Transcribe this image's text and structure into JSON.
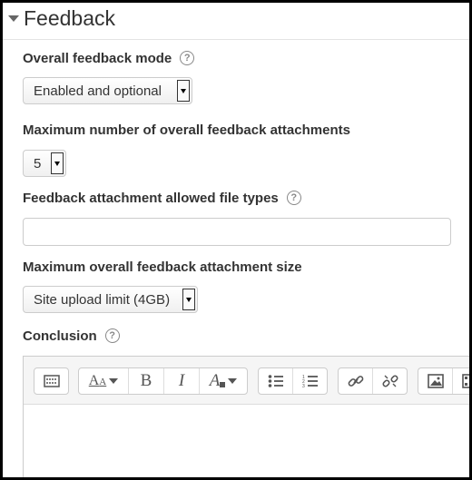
{
  "section": {
    "title": "Feedback"
  },
  "fields": {
    "feedback_mode": {
      "label": "Overall feedback mode",
      "value": "Enabled and optional"
    },
    "max_attachments": {
      "label": "Maximum number of overall feedback attachments",
      "value": "5"
    },
    "file_types": {
      "label": "Feedback attachment allowed file types",
      "value": ""
    },
    "max_size": {
      "label": "Maximum overall feedback attachment size",
      "value": "Site upload limit (4GB)"
    },
    "conclusion": {
      "label": "Conclusion"
    }
  },
  "help_glyph": "?",
  "toolbar": {
    "bold": "B",
    "italic": "I"
  }
}
